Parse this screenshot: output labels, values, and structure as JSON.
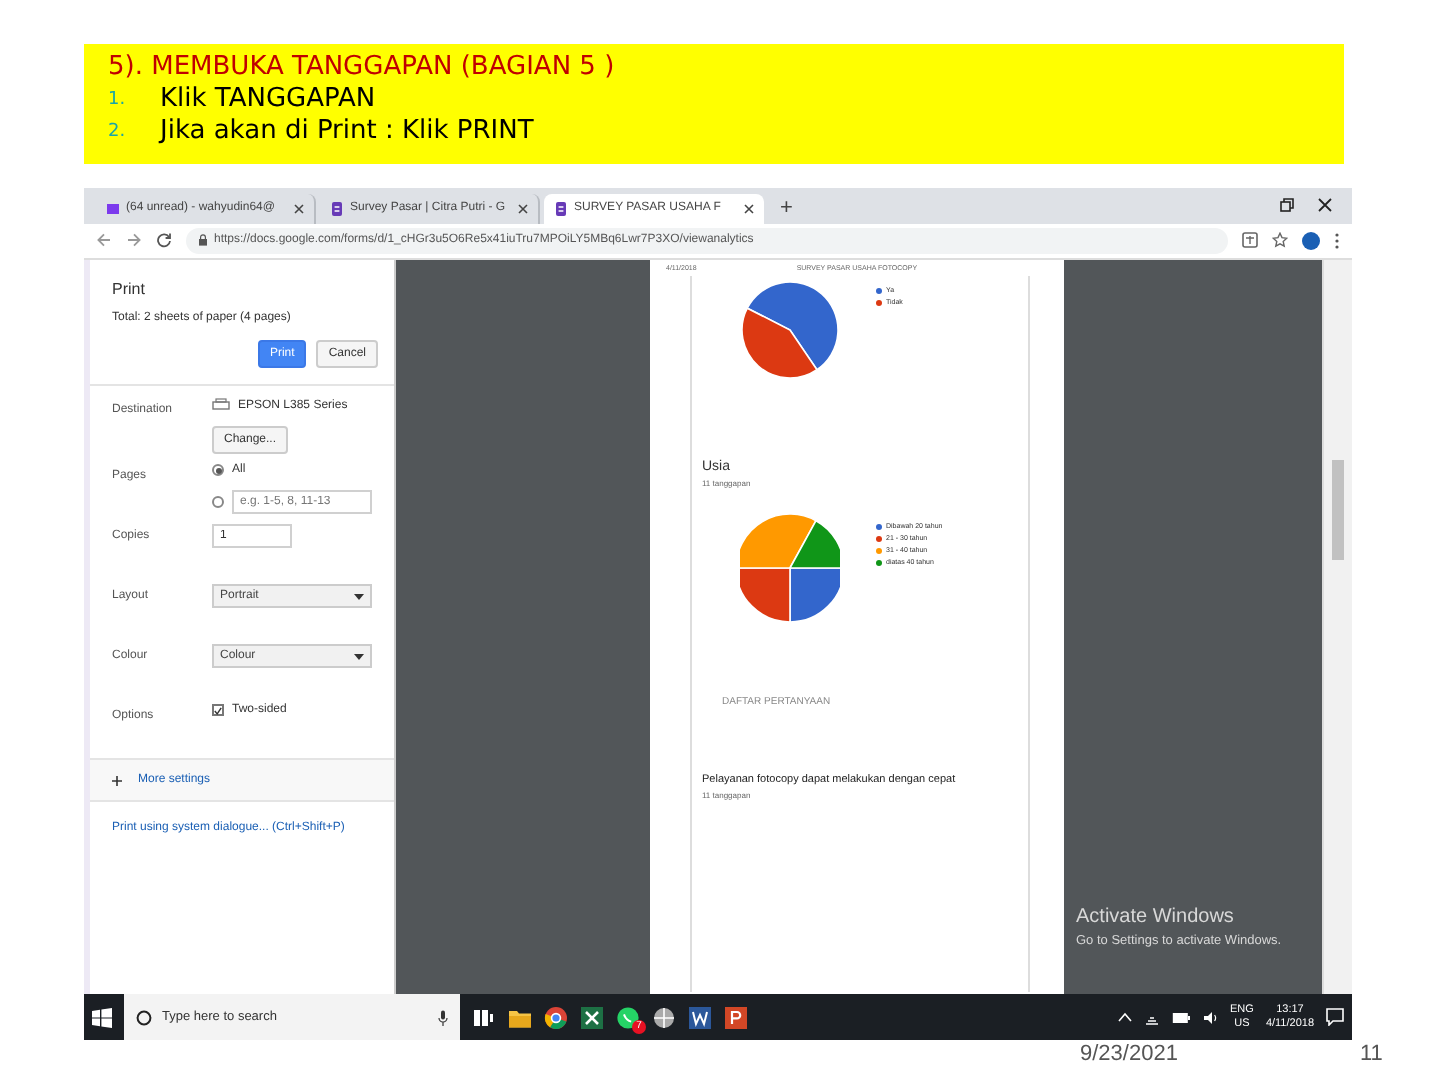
{
  "slide": {
    "heading": "5). MEMBUKA TANGGAPAN (BAGIAN  5 )",
    "steps": [
      {
        "number": "1.",
        "text": "Klik TANGGAPAN"
      },
      {
        "number": "2.",
        "text": "Jika akan di Print : Klik  PRINT"
      }
    ],
    "date": "9/23/2021",
    "page_number": "11"
  },
  "browser": {
    "tabs": [
      {
        "label": "(64 unread) - wahyudin64@",
        "selected": false
      },
      {
        "label": "Survey Pasar | Citra Putri - G",
        "selected": false
      },
      {
        "label": "SURVEY PASAR USAHA F",
        "selected": true
      }
    ],
    "new_tab": "+",
    "url": "https://docs.google.com/forms/d/1_cHGr3u5O6Re5x41iuTru7MPOiLY5MBq6Lwr7P3XO/viewanalytics"
  },
  "print_dialog": {
    "title": "Print",
    "summary": "Total: 2 sheets of paper (4 pages)",
    "buttons": [
      {
        "label": "Print",
        "kind": "primary"
      },
      {
        "label": "Cancel",
        "kind": "secondary"
      }
    ],
    "settings": [
      {
        "kind": "destination",
        "label": "Destination",
        "value": "EPSON L385 Series",
        "button": "Change..."
      },
      {
        "kind": "pages",
        "label": "Pages",
        "options": [
          {
            "label": "All",
            "selected": true
          },
          {
            "placeholder": "e.g. 1-5, 8, 11-13",
            "selected": false
          }
        ]
      },
      {
        "kind": "input",
        "label": "Copies",
        "value": "1"
      },
      {
        "kind": "select",
        "label": "Layout",
        "value": "Portrait"
      },
      {
        "kind": "select",
        "label": "Colour",
        "value": "Colour"
      },
      {
        "kind": "checkbox",
        "label": "Options",
        "text": "Two-sided",
        "checked": true
      }
    ],
    "more_settings": "More settings",
    "system_dialog": "Print using system dialogue... (Ctrl+Shift+P)"
  },
  "preview": {
    "header_date": "4/11/2018",
    "header_title": "SURVEY PASAR USAHA FOTOCOPY",
    "charts": [
      {
        "legend": [
          {
            "label": "Ya",
            "color": "#3366cc"
          },
          {
            "label": "Tidak",
            "color": "#dc3912"
          }
        ]
      },
      {
        "title": "Usia",
        "responses": "11 tanggapan",
        "legend": [
          {
            "label": "Dibawah 20 tahun",
            "color": "#3366cc"
          },
          {
            "label": "21 - 30 tahun",
            "color": "#dc3912"
          },
          {
            "label": "31 - 40 tahun",
            "color": "#ff9900"
          },
          {
            "label": "diatas 40 tahun",
            "color": "#109618"
          }
        ]
      }
    ],
    "section": "DAFTAR PERTANYAAN",
    "question": {
      "title": "Pelayanan fotocopy dapat melakukan dengan cepat",
      "responses": "11 tanggapan"
    }
  },
  "activation_notice": {
    "title": "Activate Windows",
    "text": "Go to Settings to activate Windows."
  },
  "taskbar": {
    "search_placeholder": "Type here to search",
    "chat_badge": "7",
    "language": "ENG",
    "region": "US",
    "time": "13:17",
    "date": "4/11/2018"
  }
}
